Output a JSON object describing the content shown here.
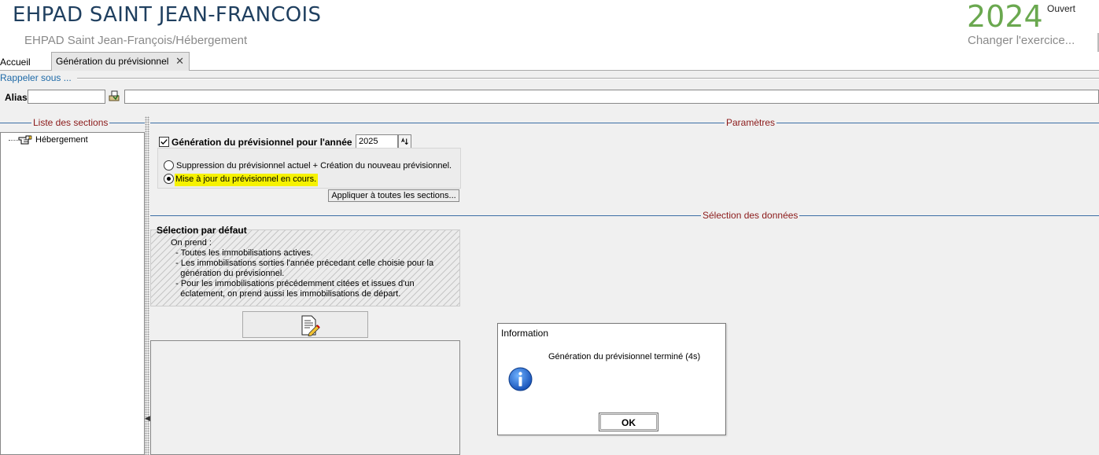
{
  "header": {
    "app_title": "EHPAD SAINT JEAN-FRANCOIS",
    "subtitle": "EHPAD Saint Jean-François/Hébergement",
    "year": "2024",
    "year_status": "Ouvert",
    "change_year_link": "Changer l'exercice..."
  },
  "tabs": {
    "home": "Accueil",
    "active": "Génération du prévisionnel",
    "close_glyph": "✕"
  },
  "recall": {
    "label": "Rappeler sous ...",
    "alias_label": "Alias",
    "alias_value": "",
    "alias_icon": "pick-icon",
    "description_value": ""
  },
  "sections": {
    "list_title": "Liste des sections",
    "params_title": "Paramètres",
    "data_selection_title": "Sélection des données"
  },
  "tree": {
    "items": [
      {
        "label": "Hébergement",
        "icon": "pointing-hand-icon"
      }
    ]
  },
  "params": {
    "generate_label": "Génération du prévisionnel pour l'année",
    "generate_checked": true,
    "year_value": "2025",
    "option_replace": "Suppression du prévisionnel actuel + Création du nouveau prévisionnel.",
    "option_update": "Mise à jour du prévisionnel en cours.",
    "selected_option": "update",
    "apply_all_button": "Appliquer à toutes les sections..."
  },
  "default_selection": {
    "title": "Sélection par défaut",
    "text": "On prend :\n  - Toutes les immobilisations actives.\n  - Les immobilisations sorties l'année précedant celle choisie pour la\n    génération du prévisionnel.\n  - Pour les immobilisations précédemment citées et issues d'un\n    éclatement, on prend aussi les immobilisations de départ."
  },
  "dialog": {
    "title": "Information",
    "message": "Génération du prévisionnel terminé (4s)",
    "icon": "info-icon",
    "ok_button": "OK"
  },
  "colors": {
    "title_blue": "#1f3f5f",
    "year_green": "#6aa84f",
    "section_red": "#8b1a1a",
    "link_blue": "#1e6aa8",
    "highlight_yellow": "#f6f200"
  }
}
